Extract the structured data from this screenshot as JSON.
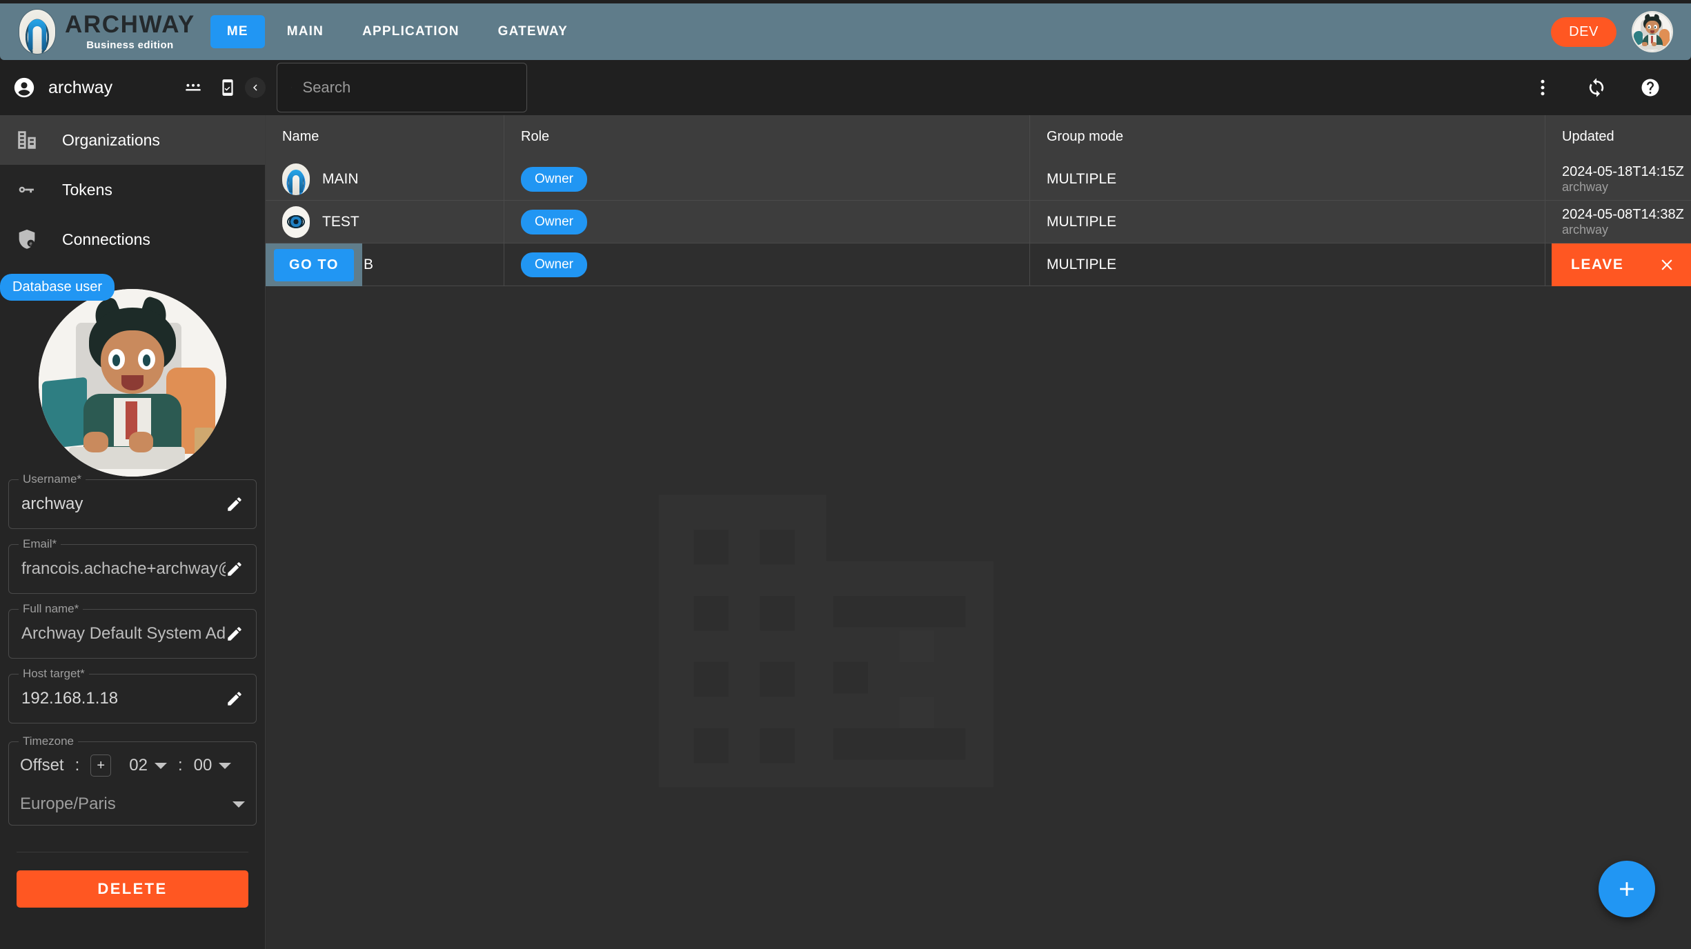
{
  "header": {
    "brand_name": "ARCHWAY",
    "brand_edition": "Business edition",
    "nav": [
      {
        "label": "ME",
        "active": true
      },
      {
        "label": "MAIN",
        "active": false
      },
      {
        "label": "APPLICATION",
        "active": false
      },
      {
        "label": "GATEWAY",
        "active": false
      }
    ],
    "env_badge": "DEV",
    "accent_blue": "#2196f3",
    "accent_orange": "#ff5722",
    "header_bg": "#5f7c8a"
  },
  "toolbar": {
    "title": "archway",
    "account_icon": "account-circle-icon",
    "password_icon": "password-icon",
    "mobile_icon": "mobile-check-icon",
    "collapse_icon": "chevron-left-icon",
    "more_icon": "more-vertical-icon",
    "refresh_icon": "sync-icon",
    "help_icon": "help-circle-icon"
  },
  "search": {
    "value": "",
    "placeholder": "Search",
    "search_icon": "search-icon",
    "clear_icon": "close-icon"
  },
  "sidebar": {
    "items": [
      {
        "label": "Organizations",
        "icon": "building-icon",
        "selected": true
      },
      {
        "label": "Tokens",
        "icon": "key-icon",
        "selected": false
      },
      {
        "label": "Connections",
        "icon": "shield-account-icon",
        "selected": false
      }
    ]
  },
  "profile": {
    "badge": "Database user",
    "fields": [
      {
        "label": "Username*",
        "value": "archway",
        "bright": true
      },
      {
        "label": "Email*",
        "value": "francois.achache+archway@",
        "bright": false
      },
      {
        "label": "Full name*",
        "value": "Archway Default System Adm",
        "bright": false
      },
      {
        "label": "Host target*",
        "value": "192.168.1.18",
        "bright": true
      }
    ],
    "timezone": {
      "label": "Timezone",
      "offset_label": "Offset",
      "colon1": ":",
      "sign": "+",
      "hours": "02",
      "colon2": ":",
      "minutes": "00",
      "zone": "Europe/Paris"
    },
    "delete_label": "DELETE"
  },
  "table": {
    "columns": [
      "Name",
      "Role",
      "Group mode",
      "Updated"
    ],
    "rows": [
      {
        "name": "MAIN",
        "icon": "archway-org-icon",
        "role": "Owner",
        "group_mode": "MULTIPLE",
        "updated_date": "2024-05-18T14:15Z",
        "updated_by": "archway"
      },
      {
        "name": "TEST",
        "icon": "eye-org-icon",
        "role": "Owner",
        "group_mode": "MULTIPLE",
        "updated_date": "2024-05-08T14:38Z",
        "updated_by": "archway"
      },
      {
        "name": "B",
        "icon": "hidden-org-icon",
        "role": "Owner",
        "group_mode": "MULTIPLE",
        "updated_date": "",
        "updated_by": ""
      }
    ],
    "goto_label": "GO TO",
    "leave_label": "LEAVE",
    "leave_close_icon": "close-icon"
  },
  "fab": {
    "icon": "plus-icon",
    "label": "+"
  }
}
